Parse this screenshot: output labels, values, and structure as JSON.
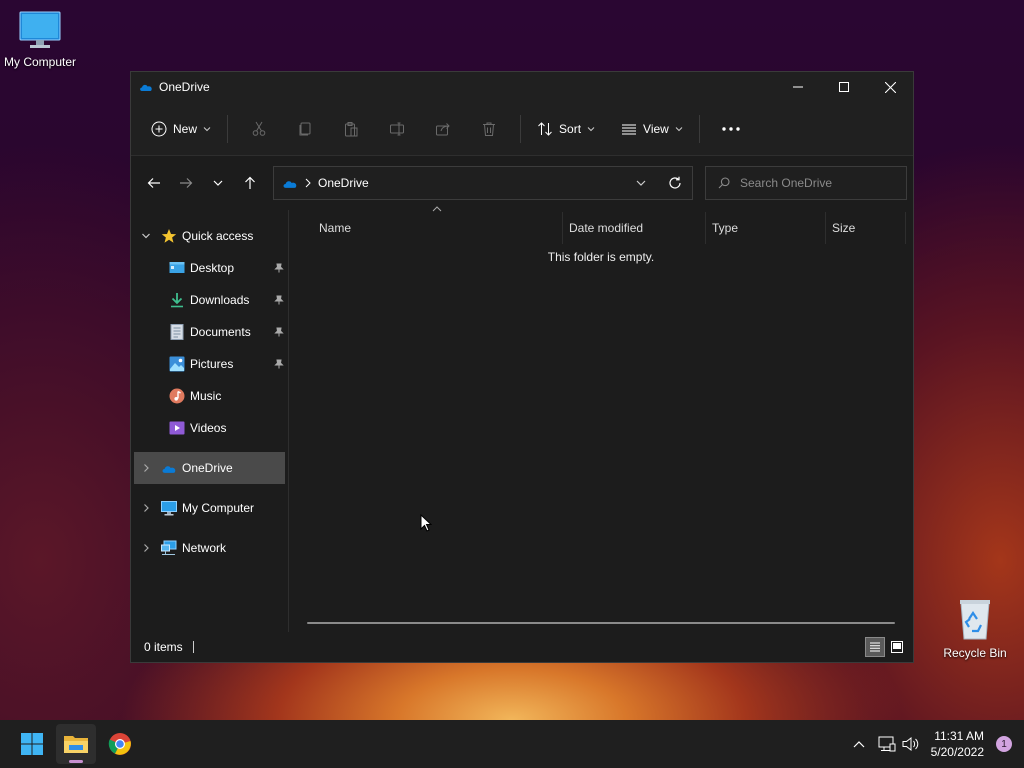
{
  "desktop": {
    "my_computer_label": "My Computer",
    "recycle_bin_label": "Recycle Bin"
  },
  "window": {
    "title": "OneDrive",
    "toolbar": {
      "new_label": "New",
      "sort_label": "Sort",
      "view_label": "View"
    },
    "address": {
      "crumb": "OneDrive"
    },
    "search": {
      "placeholder": "Search OneDrive"
    },
    "sidebar": {
      "quick_access": "Quick access",
      "items": [
        {
          "label": "Desktop",
          "icon": "desktop-folder-icon",
          "pinned": true
        },
        {
          "label": "Downloads",
          "icon": "downloads-folder-icon",
          "pinned": true
        },
        {
          "label": "Documents",
          "icon": "documents-folder-icon",
          "pinned": true
        },
        {
          "label": "Pictures",
          "icon": "pictures-folder-icon",
          "pinned": true
        },
        {
          "label": "Music",
          "icon": "music-folder-icon",
          "pinned": false
        },
        {
          "label": "Videos",
          "icon": "videos-folder-icon",
          "pinned": false
        }
      ],
      "onedrive": "OneDrive",
      "my_computer": "My Computer",
      "network": "Network"
    },
    "columns": [
      "Name",
      "Date modified",
      "Type",
      "Size"
    ],
    "empty_message": "This folder is empty.",
    "status": {
      "items_count": "0 items"
    }
  },
  "taskbar": {
    "time": "11:31 AM",
    "date": "5/20/2022",
    "notification_count": "1"
  },
  "colors": {
    "accent_blue": "#0a7bd6",
    "selected_row": "#4a4a4a",
    "window_bg": "#1c1c1c"
  }
}
